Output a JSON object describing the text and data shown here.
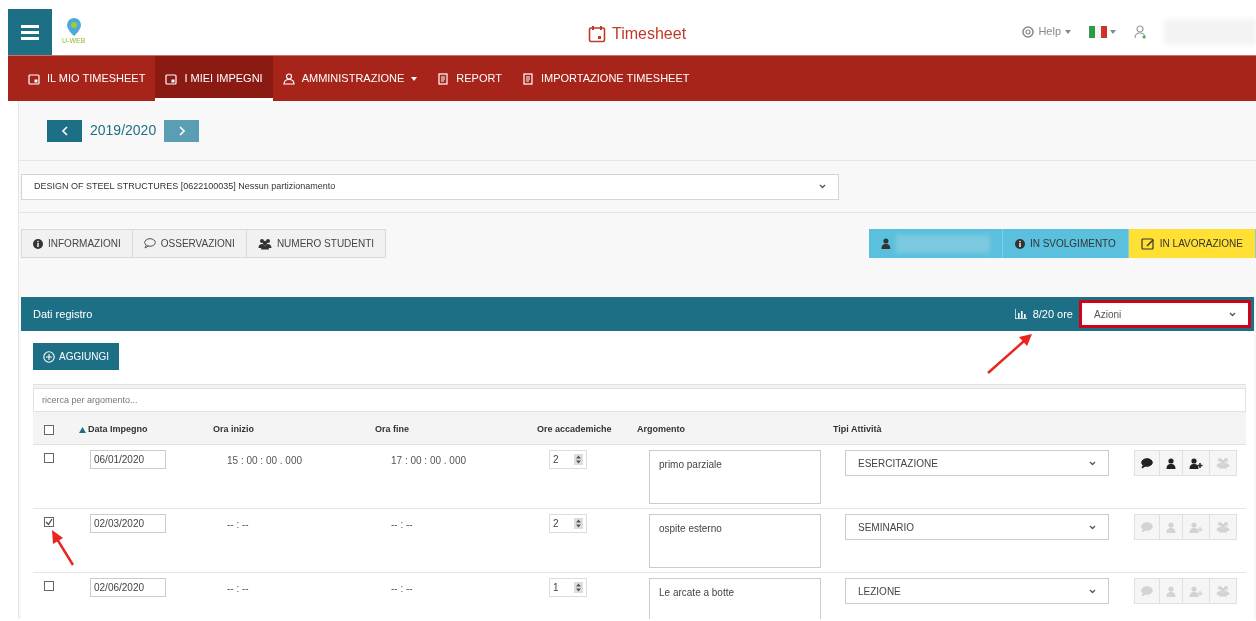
{
  "header": {
    "app_name": "U-WEB",
    "title": "Timesheet",
    "help": "Help"
  },
  "nav": [
    {
      "label": "IL MIO TIMESHEET",
      "kind": "calendar",
      "selected": false
    },
    {
      "label": "I MIEI IMPEGNI",
      "kind": "calendar",
      "selected": true
    },
    {
      "label": "AMMINISTRAZIONE",
      "kind": "admin",
      "selected": false,
      "dropdown": true
    },
    {
      "label": "REPORT",
      "kind": "doc",
      "selected": false
    },
    {
      "label": "IMPORTAZIONE TIMESHEET",
      "kind": "doc",
      "selected": false
    }
  ],
  "year": "2019/2020",
  "course_select": "DESIGN OF STEEL STRUCTURES [0622100035] Nessun partizionamento",
  "tabs": [
    {
      "label": "INFORMAZIONI",
      "kind": "info"
    },
    {
      "label": "OSSERVAZIONI",
      "kind": "comment"
    },
    {
      "label": "NUMERO STUDENTI",
      "kind": "users"
    }
  ],
  "status": [
    {
      "kind": "user",
      "color": "#5bc0de"
    },
    {
      "kind": "info",
      "label": "IN SVOLGIMENTO",
      "color": "#5bc0de"
    },
    {
      "kind": "edit",
      "label": "IN LAVORAZIONE",
      "color": "#ffe033"
    }
  ],
  "panel": {
    "title": "Dati registro",
    "hours": "8/20 ore",
    "actions_select": "Azioni",
    "add_button": "AGGIUNGI",
    "search_placeholder": "ricerca per argomento..."
  },
  "table": {
    "all_checked": false,
    "columns": [
      {
        "label": "Data Impegno",
        "sorted": true
      },
      {
        "label": "Ora inizio",
        "sorted": false
      },
      {
        "label": "Ora fine",
        "sorted": false
      },
      {
        "label": "Ore accademiche",
        "sorted": false
      },
      {
        "label": "Argomento",
        "sorted": false
      },
      {
        "label": "Tipi Attività",
        "sorted": false
      }
    ],
    "rows": [
      {
        "checked": false,
        "date": "06/01/2020",
        "start": "15 : 00 : 00 . 000",
        "end": "17 : 00 : 00 . 000",
        "hours": "2",
        "topic": "primo parziale",
        "activity": "ESERCITAZIONE",
        "actions": [
          {
            "kind": "comment",
            "disabled": false
          },
          {
            "kind": "user",
            "disabled": false
          },
          {
            "kind": "user-plus",
            "disabled": false
          },
          {
            "kind": "users",
            "disabled": true
          }
        ]
      },
      {
        "checked": true,
        "date": "02/03/2020",
        "start": "-- : --",
        "end": "-- : --",
        "hours": "2",
        "topic": "ospite esterno",
        "activity": "SEMINARIO",
        "actions": [
          {
            "kind": "comment",
            "disabled": true
          },
          {
            "kind": "user",
            "disabled": true
          },
          {
            "kind": "user-plus",
            "disabled": true
          },
          {
            "kind": "users",
            "disabled": true
          }
        ]
      },
      {
        "checked": false,
        "date": "02/06/2020",
        "start": "-- : --",
        "end": "-- : --",
        "hours": "1",
        "topic": "Le arcate a botte",
        "activity": "LEZIONE",
        "actions": [
          {
            "kind": "comment",
            "disabled": true
          },
          {
            "kind": "user",
            "disabled": true
          },
          {
            "kind": "user-plus",
            "disabled": true
          },
          {
            "kind": "users",
            "disabled": true
          }
        ]
      }
    ]
  }
}
